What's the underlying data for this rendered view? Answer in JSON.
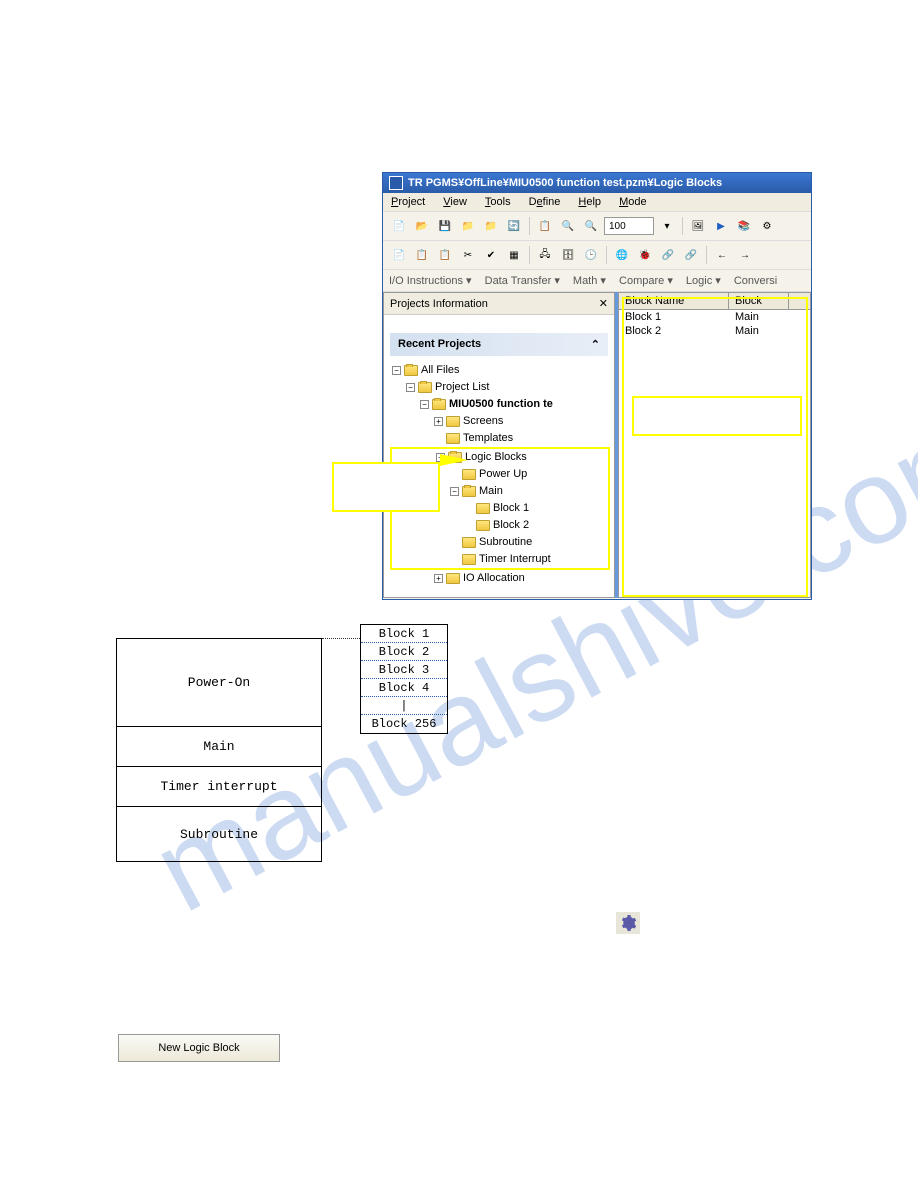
{
  "window": {
    "title": "TR PGMS¥OffLine¥MIU0500 function test.pzm¥Logic Blocks"
  },
  "menubar": {
    "items": [
      "Project",
      "View",
      "Tools",
      "Define",
      "Help",
      "Mode"
    ]
  },
  "toolbar": {
    "zoom": "100"
  },
  "instruction_bar": {
    "items": [
      "I/O Instructions  ▾",
      "Data Transfer  ▾",
      "Math  ▾",
      "Compare  ▾",
      "Logic  ▾",
      "Conversi"
    ]
  },
  "left_panel": {
    "title": "Projects Information",
    "recent_label": "Recent Projects"
  },
  "tree": {
    "all_files": "All Files",
    "project_list": "Project List",
    "project_name": "MIU0500 function te",
    "screens": "Screens",
    "templates": "Templates",
    "logic_blocks": "Logic Blocks",
    "power_up": "Power Up",
    "main": "Main",
    "block1": "Block 1",
    "block2": "Block 2",
    "subroutine": "Subroutine",
    "timer_interrupt": "Timer Interrupt",
    "io_allocation": "IO Allocation"
  },
  "right_table": {
    "headers": {
      "name": "Block Name",
      "type": "Block"
    },
    "rows": [
      {
        "name": "Block 1",
        "type": "Main"
      },
      {
        "name": "Block 2",
        "type": "Main"
      }
    ]
  },
  "diagram": {
    "lanes": [
      "Power-On",
      "Main",
      "Timer interrupt",
      "Subroutine"
    ],
    "blocks": [
      "Block 1",
      "Block 2",
      "Block 3",
      "Block 4",
      "|",
      "Block 256"
    ]
  },
  "buttons": {
    "new_logic_block": "New Logic Block"
  },
  "watermark_text": "manualshive.com"
}
